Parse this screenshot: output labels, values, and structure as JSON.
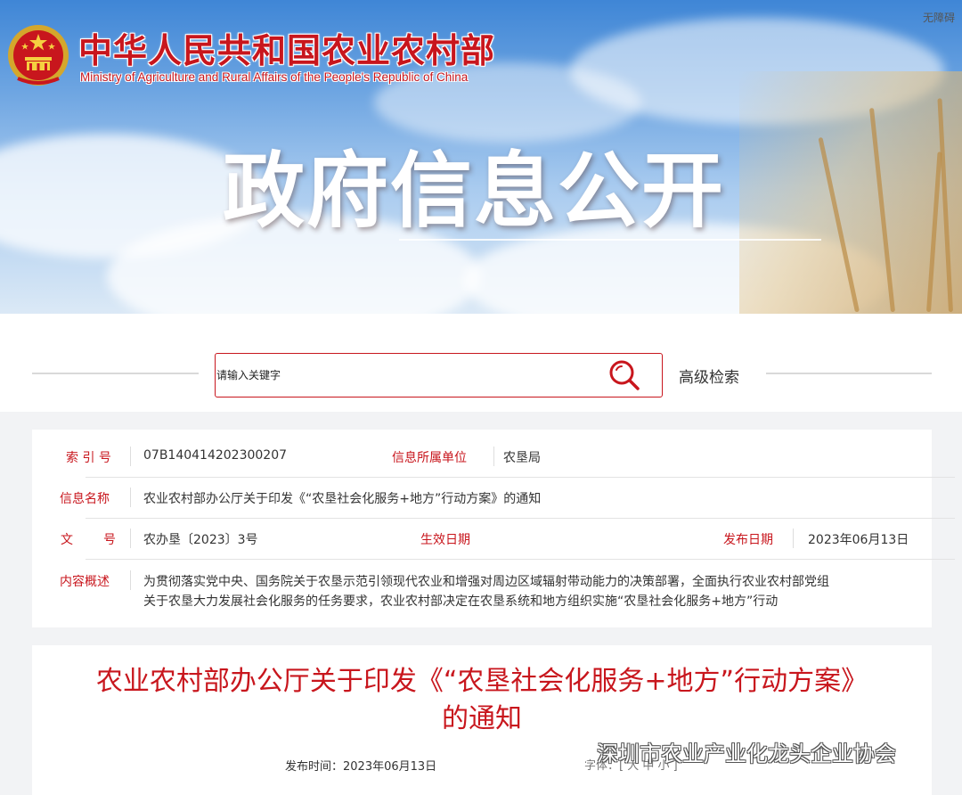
{
  "header": {
    "site_title": "中华人民共和国农业农村部",
    "site_subtitle": "Ministry of Agriculture and Rural Affairs of the People's Republic of China",
    "accessibility_label": "无障碍",
    "banner_heading": "政府信息公开",
    "emblem_icon": "national-emblem-icon"
  },
  "search": {
    "placeholder": "请输入关键字",
    "search_icon": "search-icon",
    "advanced_label": "高级检索"
  },
  "info": {
    "index_label": "索 引 号",
    "index_value": "07B140414202300207",
    "unit_label": "信息所属单位",
    "unit_value": "农垦局",
    "name_label": "信息名称",
    "name_value": "农业农村部办公厅关于印发《“农垦社会化服务+地方”行动方案》的通知",
    "doc_label_1": "文",
    "doc_label_2": "号",
    "doc_value": "农办垦〔2023〕3号",
    "effective_label": "生效日期",
    "effective_value": "",
    "publish_label": "发布日期",
    "publish_value": "2023年06月13日",
    "summary_label": "内容概述",
    "summary_line1": "为贯彻落实党中央、国务院关于农垦示范引领现代农业和增强对周边区域辐射带动能力的决策部署，全面执行农业农村部党组",
    "summary_line2": "关于农垦大力发展社会化服务的任务要求，农业农村部决定在农垦系统和地方组织实施“农垦社会化服务+地方”行动"
  },
  "article": {
    "title": "农业农村部办公厅关于印发《“农垦社会化服务+地方”行动方案》的通知",
    "publish_time": "发布时间：2023年06月13日",
    "font_size_label": "字体：[ 大 中 小 ]"
  },
  "watermark": {
    "text": "深圳市农业产业化龙头企业协会",
    "icon": "wechat-icon"
  },
  "colors": {
    "accent": "#c8161d",
    "banner_sky": "#3f86d6",
    "panel_bg": "#ffffff",
    "page_bg": "#f2f3f5"
  }
}
